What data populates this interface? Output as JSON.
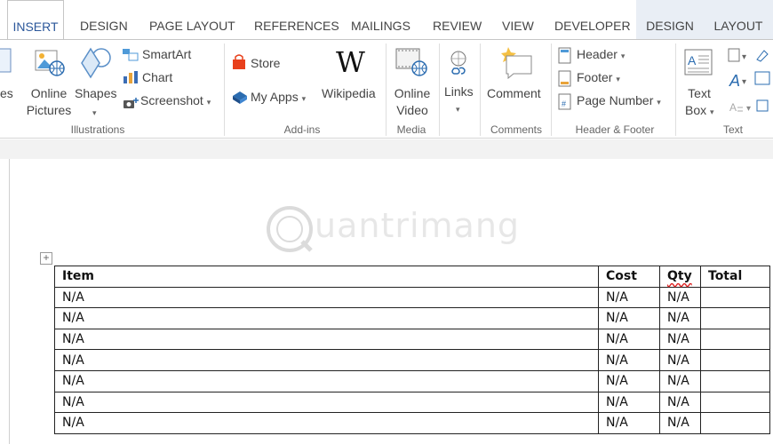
{
  "tabs": [
    "INSERT",
    "DESIGN",
    "PAGE LAYOUT",
    "REFERENCES",
    "MAILINGS",
    "REVIEW",
    "VIEW",
    "DEVELOPER",
    "DESIGN",
    "LAYOUT"
  ],
  "ribbon": {
    "illustrations": {
      "pictures_partial": "es",
      "online_pictures_1": "Online",
      "online_pictures_2": "Pictures",
      "shapes": "Shapes",
      "smartart": "SmartArt",
      "chart": "Chart",
      "screenshot": "Screenshot",
      "label": "Illustrations"
    },
    "addins": {
      "store": "Store",
      "my_apps": "My Apps",
      "wikipedia": "Wikipedia",
      "wikipedia_glyph": "W",
      "label": "Add-ins"
    },
    "media": {
      "online_video_1": "Online",
      "online_video_2": "Video",
      "label": "Media"
    },
    "links": {
      "links": "Links"
    },
    "comments": {
      "comment": "Comment",
      "label": "Comments"
    },
    "header_footer": {
      "header": "Header",
      "footer": "Footer",
      "page_number": "Page Number",
      "label": "Header & Footer"
    },
    "text": {
      "text_box_1": "Text",
      "text_box_2": "Box",
      "label": "Text"
    },
    "caret": "▾"
  },
  "watermark": {
    "text": "uantrimang",
    "glyph": "Q"
  },
  "table": {
    "headers": [
      "Item",
      "Cost",
      "Qty",
      "Total"
    ],
    "rows": [
      [
        "N/A",
        "N/A",
        "N/A",
        ""
      ],
      [
        "N/A",
        "N/A",
        "N/A",
        ""
      ],
      [
        "N/A",
        "N/A",
        "N/A",
        ""
      ],
      [
        "N/A",
        "N/A",
        "N/A",
        ""
      ],
      [
        "N/A",
        "N/A",
        "N/A",
        ""
      ],
      [
        "N/A",
        "N/A",
        "N/A",
        ""
      ],
      [
        "N/A",
        "N/A",
        "N/A",
        ""
      ]
    ],
    "move_handle": "+"
  },
  "colors": {
    "accent": "#2b579a",
    "store_red": "#e8401c",
    "apps_blue": "#2b6cb0"
  }
}
